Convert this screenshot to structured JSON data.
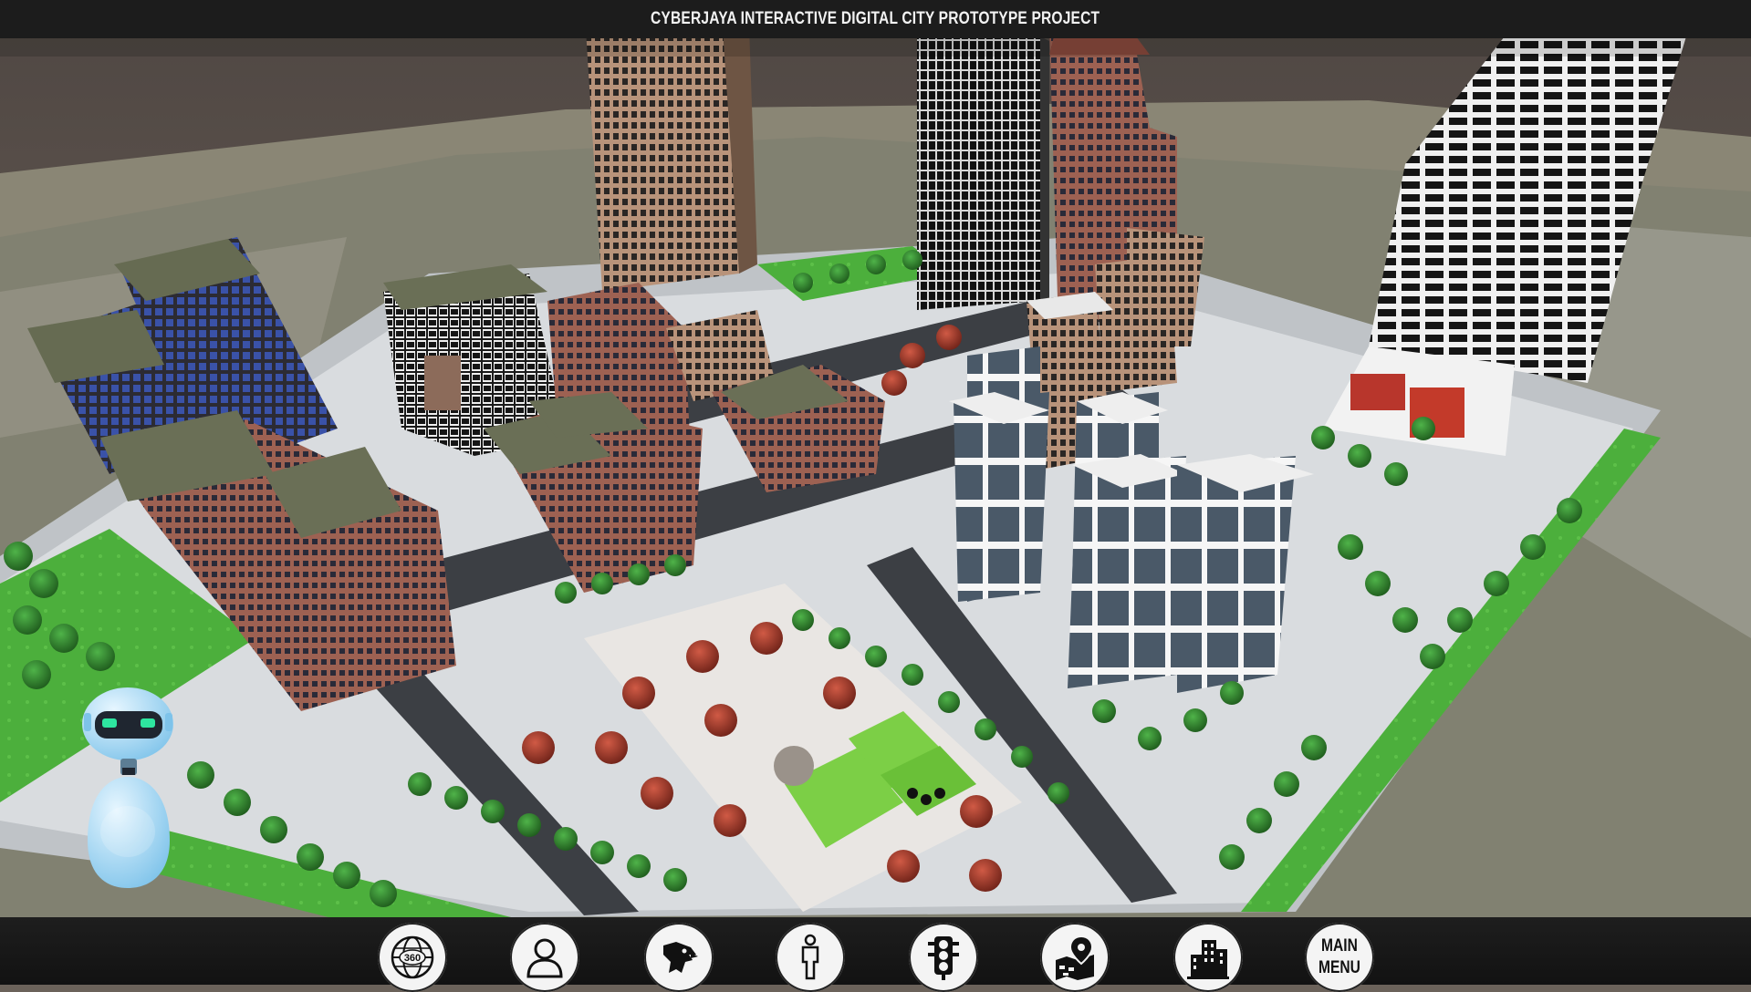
{
  "header": {
    "title": "CYBERJAYA INTERACTIVE DIGITAL CITY PROTOTYPE PROJECT"
  },
  "toolbar": {
    "buttons": [
      {
        "name": "view-360-button",
        "icon": "globe-360-icon",
        "label": "360"
      },
      {
        "name": "avatar-view-button",
        "icon": "person-icon"
      },
      {
        "name": "bird-view-button",
        "icon": "eagle-icon"
      },
      {
        "name": "walk-view-button",
        "icon": "standing-person-icon"
      },
      {
        "name": "traffic-button",
        "icon": "traffic-light-icon"
      },
      {
        "name": "map-location-button",
        "icon": "map-pin-icon"
      },
      {
        "name": "buildings-button",
        "icon": "buildings-icon"
      }
    ],
    "main_menu": {
      "line1": "MAIN",
      "line2": "MENU"
    }
  },
  "assistant": {
    "icon": "robot-assistant-icon"
  },
  "colors": {
    "bar": "#1c1c1c",
    "button_bg": "#f4f4f4",
    "grass": "#4caf3c",
    "tree": "#2e7d2a",
    "red_tree": "#a33a2c",
    "robot": "#9fd8f5",
    "robot_eyes": "#2ee6a0"
  }
}
